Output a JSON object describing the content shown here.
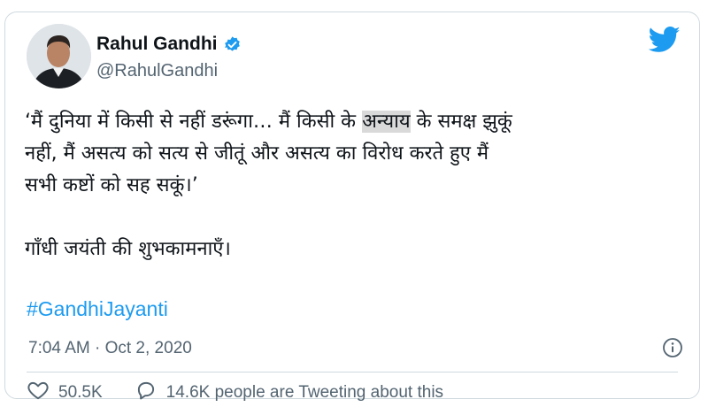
{
  "colors": {
    "accent": "#1d9bf0",
    "muted": "#536471",
    "text": "#0f1419",
    "highlight": "#d9d9d9"
  },
  "author": {
    "name": "Rahul Gandhi",
    "handle": "@RahulGandhi",
    "verified_icon": "verified-badge-icon",
    "avatar_icon": "avatar"
  },
  "brand_icon": "twitter-bird-icon",
  "tweet": {
    "line1_before": "‘मैं दुनिया में किसी से नहीं डरूंगा… मैं किसी के ",
    "line1_highlight": "अन्याय",
    "line1_after": " के समक्ष झुकूं",
    "line2": "नहीं, मैं असत्य को सत्य से जीतूं और असत्य का विरोध करते हुए मैं",
    "line3": "सभी कष्टों को सह सकूं।’",
    "line4": "गाँधी जयंती की शुभकामनाएँ।",
    "hashtag": "#GandhiJayanti"
  },
  "meta": {
    "timestamp": "7:04 AM · Oct 2, 2020",
    "info_icon": "info-icon"
  },
  "stats": {
    "likes": "50.5K",
    "like_icon": "heart-icon",
    "replies_text": "14.6K people are Tweeting about this",
    "reply_icon": "comment-icon"
  }
}
